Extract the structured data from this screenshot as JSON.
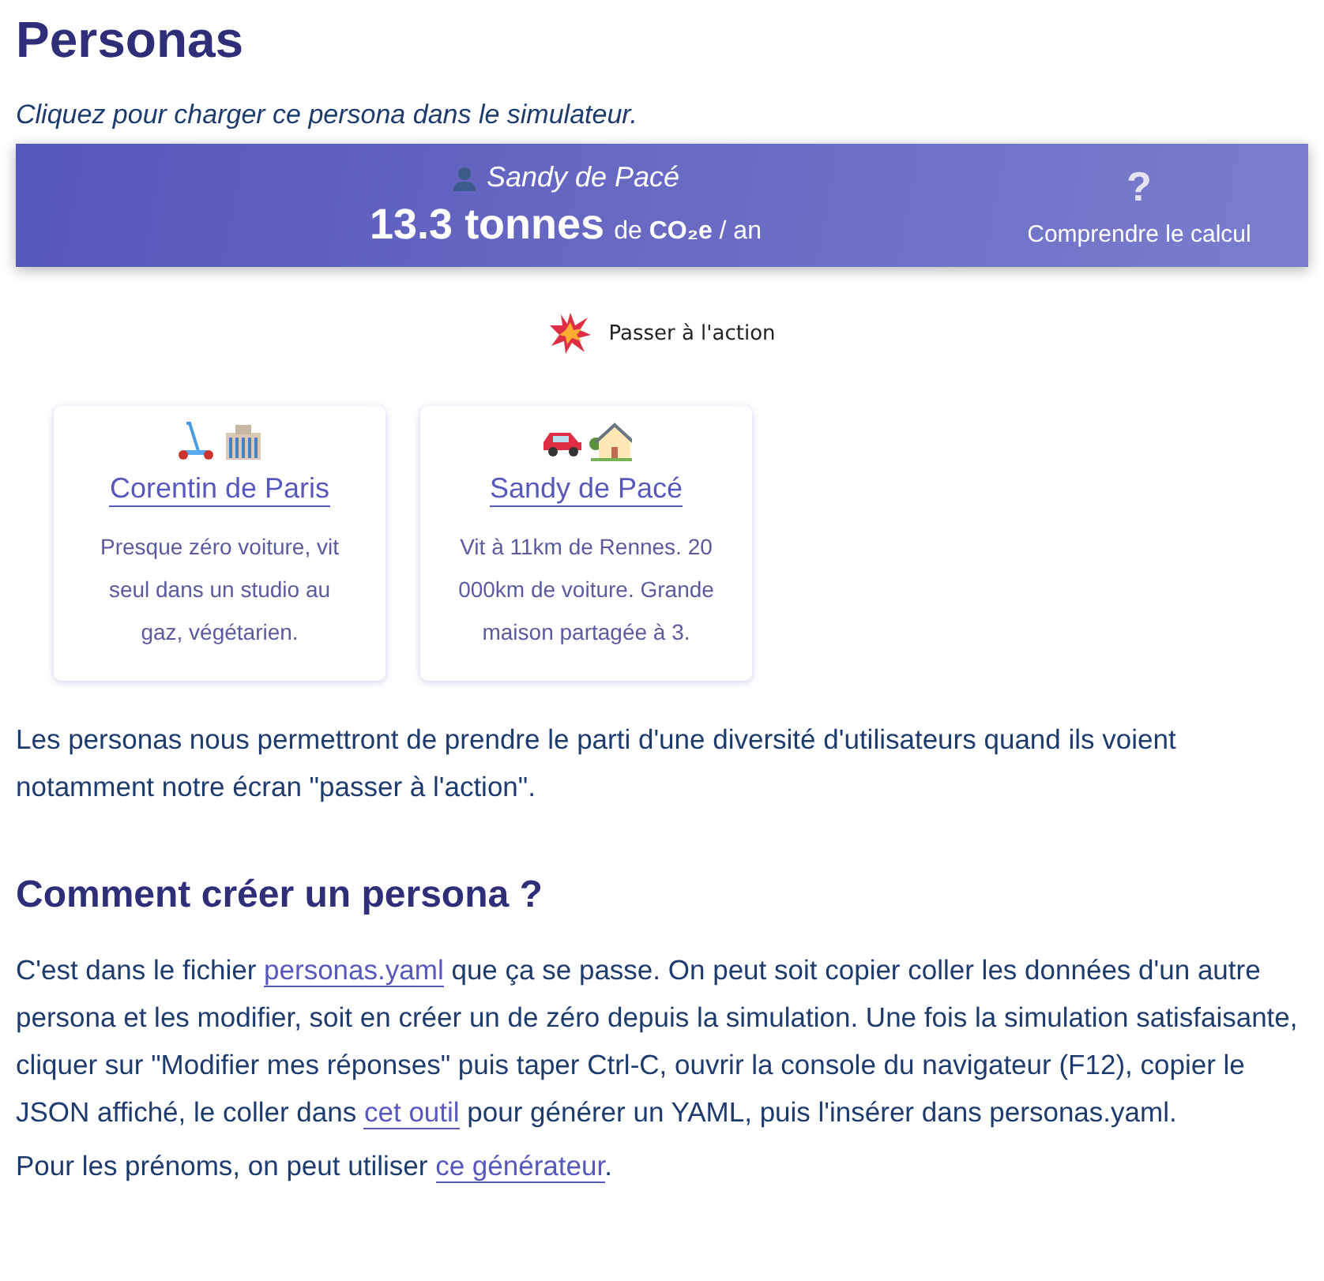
{
  "title": "Personas",
  "intro": "Cliquez pour charger ce persona dans le simulateur.",
  "banner": {
    "persona": "Sandy de Pacé",
    "value": "13.3 tonnes",
    "unit": "de **CO₂e** / an",
    "help_mark": "?",
    "help_label": "Comprendre le calcul"
  },
  "action_link": "Passer à l'action",
  "personas": [
    {
      "icons": [
        {
          "kind": "scooter"
        },
        {
          "kind": "building"
        }
      ],
      "name": "Corentin de Paris",
      "description": "Presque zéro voiture, vit seul dans un studio au gaz, végétarien."
    },
    {
      "icons": [
        {
          "kind": "car"
        },
        {
          "kind": "house"
        }
      ],
      "name": "Sandy de Pacé",
      "description": "Vit à 11km de Rennes. 20 000km de voiture. Grande maison partagée à 3."
    }
  ],
  "explanation": "Les personas nous permettront de prendre le parti d'une diversité d'utilisateurs quand ils voient notamment notre écran \"passer à l'action\".",
  "section_title": "Comment créer un persona ?",
  "paragraphs": [
    [
      {
        "kind": "text",
        "text": "C'est dans le fichier "
      },
      {
        "kind": "link",
        "text": "personas.yaml"
      },
      {
        "kind": "text",
        "text": " que ça se passe. On peut soit copier coller les données d'un autre persona et les modifier, soit en créer un de zéro depuis la simulation. Une fois la simulation satisfaisante, cliquer sur \"Modifier mes réponses\" puis taper Ctrl-C, ouvrir la console du navigateur (F12), copier le JSON affiché, le coller dans "
      },
      {
        "kind": "link",
        "text": "cet outil"
      },
      {
        "kind": "text",
        "text": " pour générer un YAML, puis l'insérer dans personas.yaml."
      }
    ],
    [
      {
        "kind": "text",
        "text": "Pour les prénoms, on peut utiliser "
      },
      {
        "kind": "link",
        "text": "ce générateur"
      },
      {
        "kind": "text",
        "text": "."
      }
    ]
  ]
}
